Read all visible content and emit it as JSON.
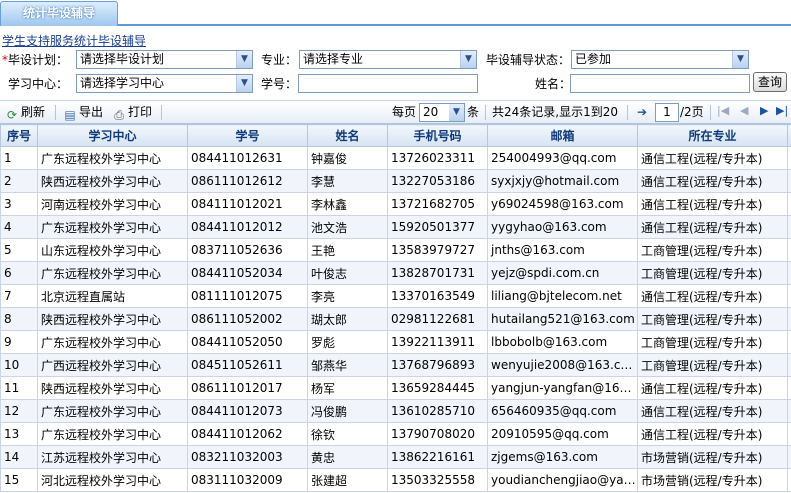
{
  "tab": {
    "label": "统计毕设辅导"
  },
  "breadcrumb": "学生支持服务统计毕设辅导",
  "filters": {
    "plan_label": "毕设计划：",
    "plan_required_mark": "*",
    "plan_value": "请选择毕设计划",
    "major_label": "专业：",
    "major_value": "请选择专业",
    "status_label": "毕设辅导状态：",
    "status_value": "已参加",
    "center_label": "学习中心：",
    "center_value": "请选择学习中心",
    "studentno_label": "学号：",
    "name_label": "姓名：",
    "query_button": "查询"
  },
  "toolbar": {
    "refresh": "刷新",
    "export": "导出",
    "print": "打印",
    "per_page_prefix": "每页",
    "per_page_value": "20",
    "per_page_suffix": "条",
    "record_info": "共24条记录,显示1到20",
    "page_value": "1",
    "page_total": "/2页"
  },
  "table": {
    "columns": [
      "序号",
      "学习中心",
      "学号",
      "姓名",
      "手机号码",
      "邮箱",
      "所在专业"
    ],
    "rows": [
      [
        "1",
        "广东远程校外学习中心",
        "084411012631",
        "钟嘉俊",
        "13726023311",
        "254004993@qq.com",
        "通信工程(远程/专升本)"
      ],
      [
        "2",
        "陕西远程校外学习中心",
        "086111012612",
        "李慧",
        "13227053186",
        "syxjxjy@hotmail.com",
        "通信工程(远程/专升本)"
      ],
      [
        "3",
        "河南远程校外学习中心",
        "084111012021",
        "李林鑫",
        "13721682705",
        "y69024598@163.com",
        "通信工程(远程/专升本)"
      ],
      [
        "4",
        "广东远程校外学习中心",
        "084411012012",
        "池文浩",
        "15920501377",
        "yygyhao@163.com",
        "通信工程(远程/专升本)"
      ],
      [
        "5",
        "山东远程校外学习中心",
        "083711052636",
        "王艳",
        "13583979727",
        "jnths@163.com",
        "工商管理(远程/专升本)"
      ],
      [
        "6",
        "广东远程校外学习中心",
        "084411052034",
        "叶俊志",
        "13828701731",
        "yejz@spdi.com.cn",
        "工商管理(远程/专升本)"
      ],
      [
        "7",
        "北京远程直属站",
        "081111012075",
        "李亮",
        "13370163549",
        "liliang@bjtelecom.net",
        "通信工程(远程/专升本)"
      ],
      [
        "8",
        "陕西远程校外学习中心",
        "086111052002",
        "瑚太郎",
        "02981122681",
        "hutailang521@163.com",
        "工商管理(远程/专升本)"
      ],
      [
        "9",
        "广东远程校外学习中心",
        "084411052050",
        "罗彪",
        "13922113911",
        "lbbobolb@163.com",
        "工商管理(远程/专升本)"
      ],
      [
        "10",
        "广西远程校外学习中心",
        "084511052611",
        "邹燕华",
        "13768796893",
        "wenyujie2008@163.com",
        "工商管理(远程/专升本)"
      ],
      [
        "11",
        "陕西远程校外学习中心",
        "086111012017",
        "杨军",
        "13659284445",
        "yangjun-yangfan@163.c...",
        "通信工程(远程/专升本)"
      ],
      [
        "12",
        "广东远程校外学习中心",
        "084411012073",
        "冯俊鹏",
        "13610285710",
        "656460935@qq.com",
        "通信工程(远程/专升本)"
      ],
      [
        "13",
        "广东远程校外学习中心",
        "084411012062",
        "徐钦",
        "13790708020",
        "20910595@qq.com",
        "通信工程(远程/专升本)"
      ],
      [
        "14",
        "江苏远程校外学习中心",
        "083211032003",
        "黄忠",
        "13862216161",
        "zjgems@163.com",
        "市场营销(远程/专升本)"
      ],
      [
        "15",
        "河北远程校外学习中心",
        "083111032009",
        "张建超",
        "13503325558",
        "youdianchengjiao@yaho...",
        "市场营销(远程/专升本)"
      ]
    ]
  }
}
